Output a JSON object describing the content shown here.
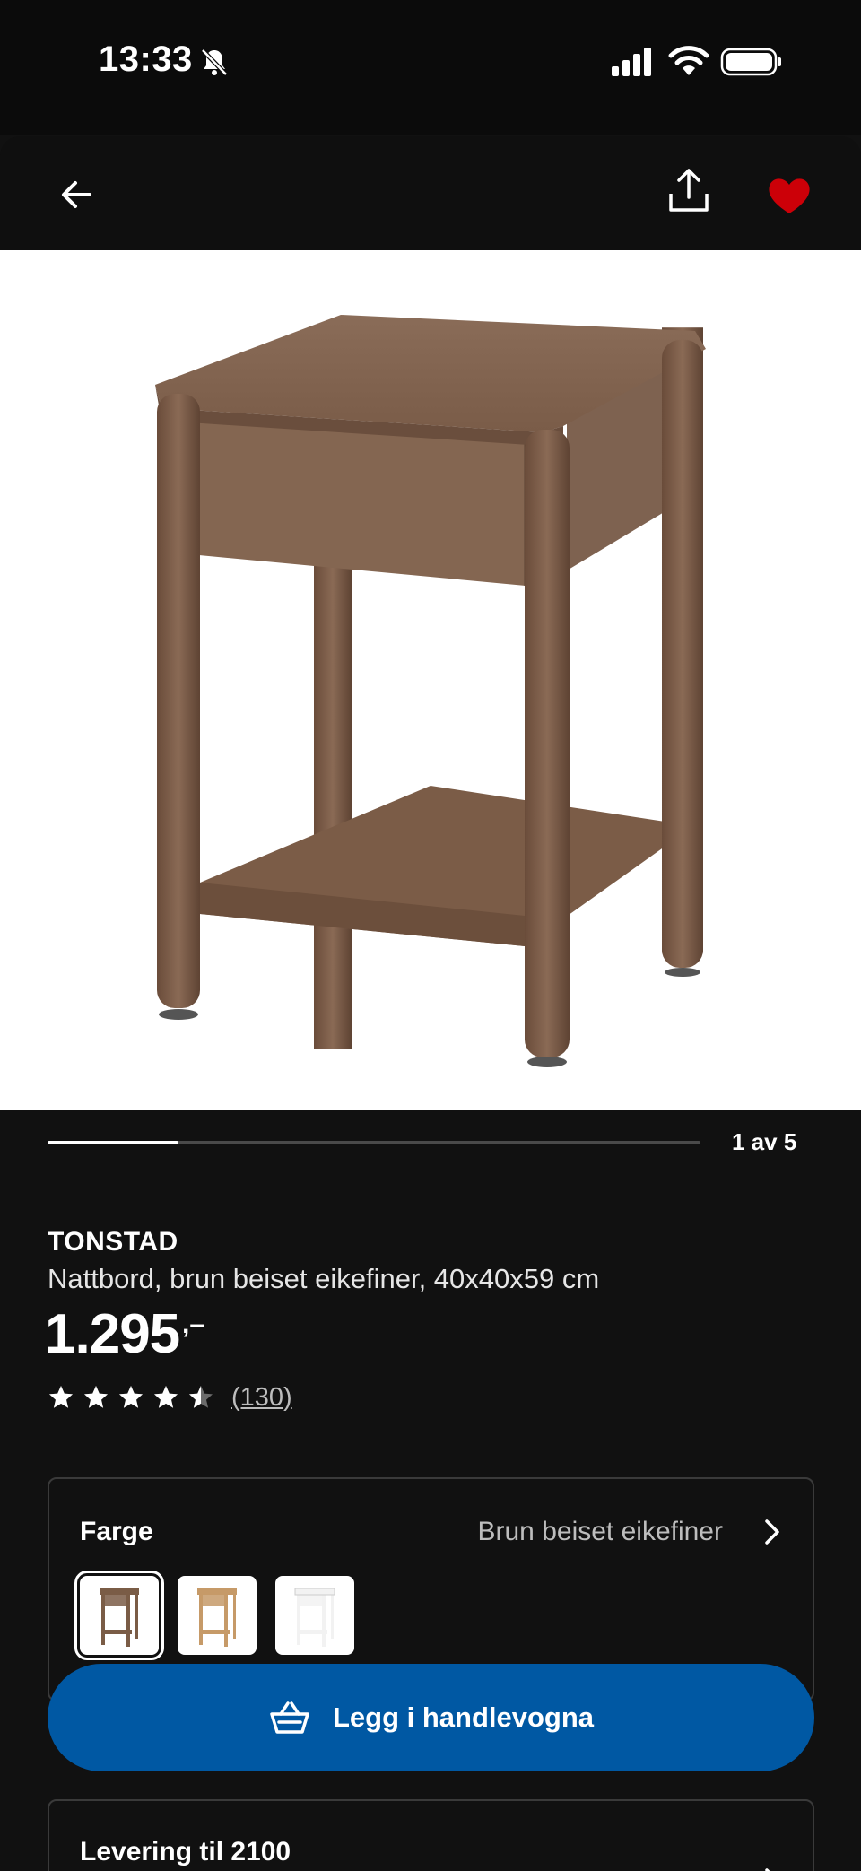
{
  "status_bar": {
    "time": "13:33"
  },
  "nav": {
    "back_icon": "arrow-left-icon",
    "share_icon": "share-icon",
    "favourite_icon": "heart-icon",
    "favourite_color": "#cc0008"
  },
  "carousel": {
    "counter": "1 av 5",
    "progress": 0.2
  },
  "product": {
    "brand": "TONSTAD",
    "description": "Nattbord, brun beiset eikefiner, 40x40x59 cm",
    "price": "1.295",
    "price_suffix": ",–",
    "rating": 4.5,
    "review_count": "(130)"
  },
  "colour": {
    "label": "Farge",
    "value": "Brun beiset eikefiner",
    "options": [
      {
        "name": "brown-stained-oak",
        "color": "#7a5c46",
        "selected": true
      },
      {
        "name": "oak",
        "color": "#c69a68",
        "selected": false
      },
      {
        "name": "white",
        "color": "#f2f2f2",
        "selected": false
      }
    ]
  },
  "cart": {
    "label": "Legg i handlevogna",
    "button_color": "#0058a3"
  },
  "delivery": {
    "label": "Levering til 2100"
  }
}
